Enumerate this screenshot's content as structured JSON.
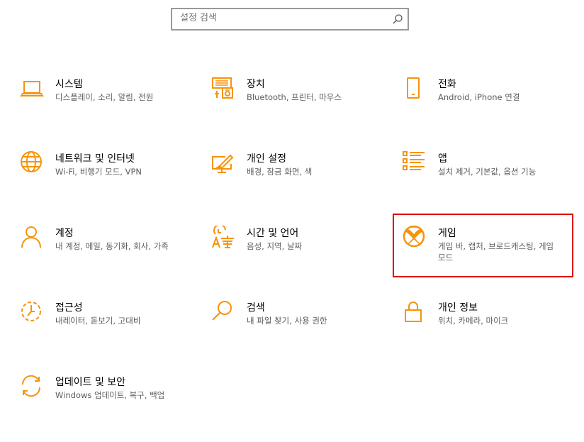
{
  "search": {
    "placeholder": "설정 검색"
  },
  "accent_color": "#f7930a",
  "highlight_color": "#e00000",
  "tiles": [
    {
      "title": "시스템",
      "desc": "디스플레이, 소리, 알림, 전원",
      "icon": "laptop-icon"
    },
    {
      "title": "장치",
      "desc": "Bluetooth, 프린터, 마우스",
      "icon": "devices-icon"
    },
    {
      "title": "전화",
      "desc": "Android, iPhone 연결",
      "icon": "phone-icon"
    },
    {
      "title": "네트워크 및 인터넷",
      "desc": "Wi-Fi, 비행기 모드, VPN",
      "icon": "globe-icon"
    },
    {
      "title": "개인 설정",
      "desc": "배경, 잠금 화면, 색",
      "icon": "personalization-icon"
    },
    {
      "title": "앱",
      "desc": "설치 제거, 기본값, 옵션 기능",
      "icon": "apps-list-icon"
    },
    {
      "title": "계정",
      "desc": "내 계정, 메일, 동기화, 회사, 가족",
      "icon": "person-icon"
    },
    {
      "title": "시간 및 언어",
      "desc": "음성, 지역, 날짜",
      "icon": "time-language-icon"
    },
    {
      "title": "게임",
      "desc": "게임 바, 캡처, 브로드캐스팅, 게임 모드",
      "icon": "xbox-icon"
    },
    {
      "title": "접근성",
      "desc": "내레이터, 돋보기, 고대비",
      "icon": "ease-of-access-icon"
    },
    {
      "title": "검색",
      "desc": "내 파일 찾기, 사용 권한",
      "icon": "search-icon"
    },
    {
      "title": "개인 정보",
      "desc": "위치, 카메라, 마이크",
      "icon": "lock-icon"
    },
    {
      "title": "업데이트 및 보안",
      "desc": "Windows 업데이트, 복구, 백업",
      "icon": "sync-icon"
    }
  ]
}
